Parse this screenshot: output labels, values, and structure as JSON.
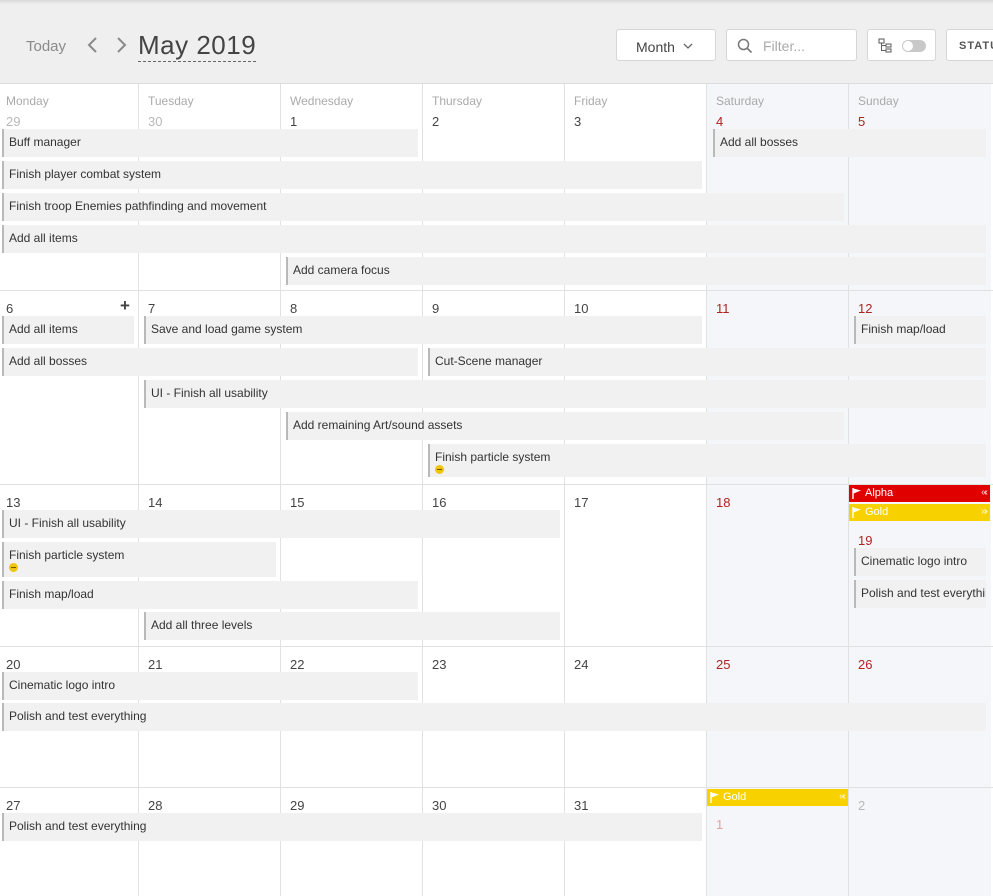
{
  "header": {
    "today_label": "Today",
    "title": "May 2019",
    "view_label": "Month",
    "filter_placeholder": "Filter...",
    "status_label": "STATU"
  },
  "weekdays": [
    "Monday",
    "Tuesday",
    "Wednesday",
    "Thursday",
    "Friday",
    "Saturday",
    "Sunday"
  ],
  "weeks": [
    {
      "days": [
        "29",
        "30",
        "1",
        "2",
        "3",
        "4",
        "5"
      ]
    },
    {
      "days": [
        "6",
        "7",
        "8",
        "9",
        "10",
        "11",
        "12"
      ]
    },
    {
      "days": [
        "13",
        "14",
        "15",
        "16",
        "17",
        "18",
        "19"
      ]
    },
    {
      "days": [
        "20",
        "21",
        "22",
        "23",
        "24",
        "25",
        "26"
      ]
    },
    {
      "days": [
        "27",
        "28",
        "29",
        "30",
        "31",
        "1",
        "2"
      ]
    }
  ],
  "events": [
    {
      "label": "Buff manager"
    },
    {
      "label": "Add all bosses"
    },
    {
      "label": "Finish player combat system"
    },
    {
      "label": "Finish troop Enemies pathfinding and movement"
    },
    {
      "label": "Add all items"
    },
    {
      "label": "Add camera focus"
    },
    {
      "label": "Add all items"
    },
    {
      "label": "Save and load game system"
    },
    {
      "label": "Finish map/load"
    },
    {
      "label": "Add all bosses"
    },
    {
      "label": "Cut-Scene manager"
    },
    {
      "label": "UI - Finish all usability"
    },
    {
      "label": "Add remaining Art/sound assets"
    },
    {
      "label": "Finish particle system"
    },
    {
      "label": "UI - Finish all usability"
    },
    {
      "label": "Finish particle system"
    },
    {
      "label": "Finish map/load"
    },
    {
      "label": "Add all three levels"
    },
    {
      "label": "Cinematic logo intro"
    },
    {
      "label": "Polish and test everything"
    },
    {
      "label": "Cinematic logo intro"
    },
    {
      "label": "Polish and test everything"
    },
    {
      "label": "Polish and test everything"
    }
  ],
  "milestones": [
    {
      "label": "Alpha",
      "color": "#e00000",
      "arrows": "«‹"
    },
    {
      "label": "Gold",
      "color": "#f7d200",
      "arrows": "»›"
    },
    {
      "label": "Gold",
      "color": "#f7d200",
      "arrows": "«‹"
    }
  ],
  "colors": {
    "accent_red": "#e00000",
    "accent_gold": "#f7d200",
    "weekend_num": "#b22222"
  }
}
